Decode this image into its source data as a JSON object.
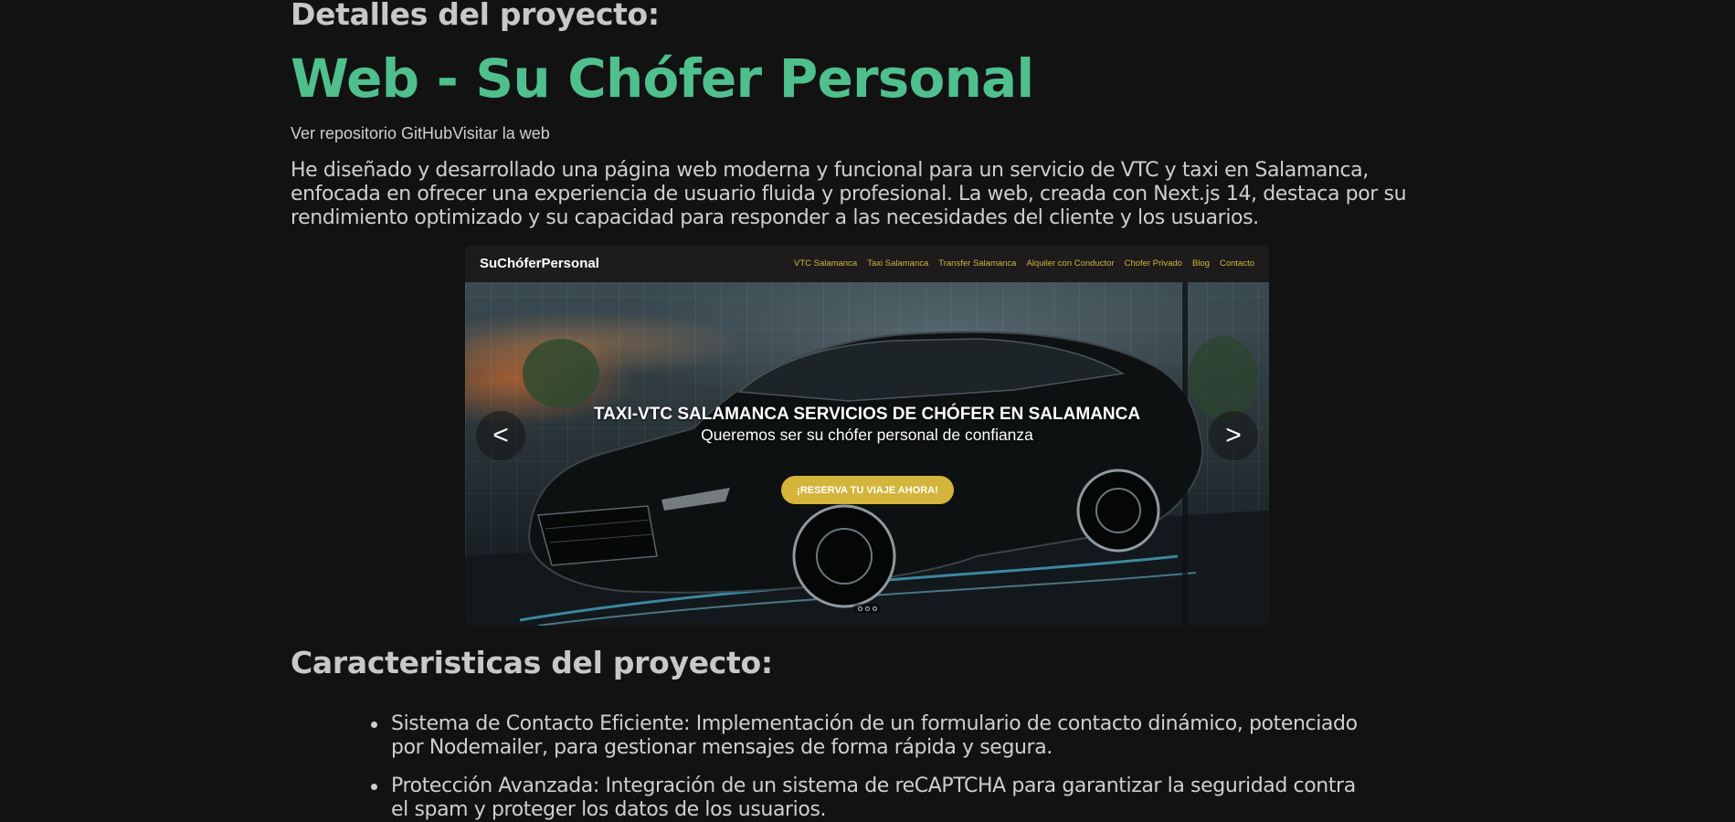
{
  "details_heading": "Detalles del proyecto:",
  "project_title": "Web - Su Chófer Personal",
  "links": {
    "github": "Ver repositorio GitHub",
    "site": "Visitar la web"
  },
  "description": "He diseñado y desarrollado una página web moderna y funcional para un servicio de VTC y taxi en Salamanca, enfocada en ofrecer una experiencia de usuario fluida y profesional. La web, creada con Next.js 14, destaca por su rendimiento optimizado y su capacidad para responder a las necesidades del cliente y los usuarios.",
  "preview": {
    "logo": "SuChóferPersonal",
    "menu": [
      "VTC Salamanca",
      "Taxi Salamanca",
      "Transfer Salamanca",
      "Alquiler con Conductor",
      "Chofer Privado",
      "Blog",
      "Contacto"
    ],
    "hero_title": "TAXI-VTC SALAMANCA SERVICIOS DE CHÓFER EN SALAMANCA",
    "hero_subtitle": "Queremos ser su chófer personal de confianza",
    "cta": "¡RESERVA TU VIAJE AHORA!",
    "prev_arrow": "<",
    "next_arrow": ">",
    "accent_color": "#d4b43b"
  },
  "features_heading": "Caracteristicas del proyecto:",
  "features": [
    "Sistema de Contacto Eficiente: Implementación de un formulario de contacto dinámico, potenciado por Nodemailer, para gestionar mensajes de forma rápida y segura.",
    "Protección Avanzada: Integración de un sistema de reCAPTCHA para garantizar la seguridad contra el spam y proteger los datos de los usuarios."
  ],
  "colors": {
    "background": "#121212",
    "title_green": "#4fc08d",
    "text": "#cfcfcf"
  }
}
